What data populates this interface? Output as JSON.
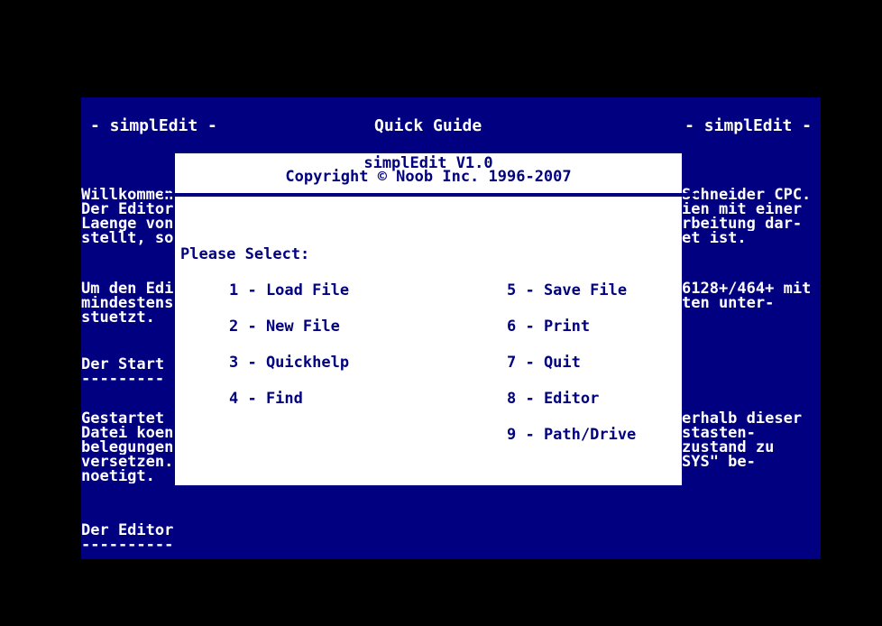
{
  "header": {
    "left": "- simplEdit -",
    "center": "Quick Guide",
    "right": "- simplEdit -"
  },
  "background_text": {
    "left": [
      "Willkommen",
      "Der Editor",
      "Laenge von",
      "stellt, so",
      "",
      "Um den Edi",
      "mindestens",
      "stuetzt.",
      "",
      "Der Start",
      "---------",
      "",
      "Gestartet",
      "Datei koen",
      "belegungen",
      "versetzen.",
      "noetigt.",
      "",
      "Der Editor",
      "----------"
    ],
    "right": [
      "",
      "Schneider CPC.",
      "ien mit einer",
      "rbeitung dar-",
      "et ist.",
      "",
      "6128+/464+ mit",
      "ten unter-",
      "",
      "",
      "",
      "",
      "erhalb dieser",
      "stasten-",
      "zustand zu",
      "SYS\" be-",
      "",
      "",
      "",
      ""
    ]
  },
  "dialog": {
    "title": "simplEdit V1.0",
    "copyright": "Copyright © Noob Inc. 1996-2007",
    "prompt": "Please Select:",
    "options_left": [
      "1 - Load File",
      "2 - New File",
      "3 - Quickhelp",
      "4 - Find"
    ],
    "options_right": [
      "5 - Save File",
      "6 - Print",
      "7 - Quit",
      "8 - Editor",
      "9 - Path/Drive"
    ]
  },
  "colors": {
    "screen_background": "#000080",
    "text": "#ffffff",
    "dialog_background": "#ffffff",
    "dialog_text": "#000080",
    "border": "#000000"
  }
}
